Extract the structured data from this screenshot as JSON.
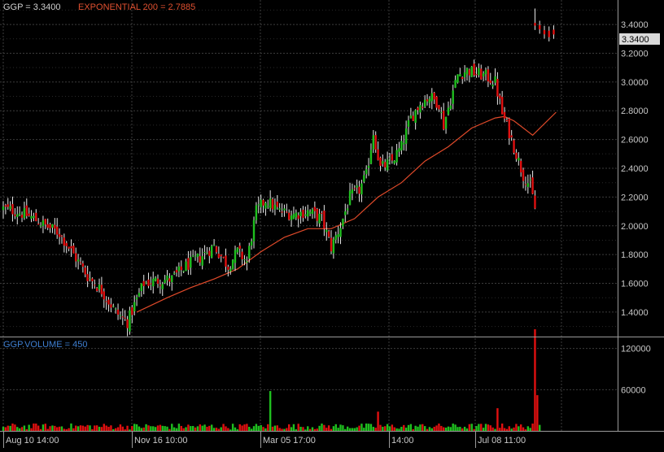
{
  "header": {
    "symbol_label": "GGP = 3.3400",
    "ema_label": "EXPONENTIAL 200 = 2.7885",
    "volume_label": "GGP.VOLUME = 450",
    "last_price_tag": "3.3400"
  },
  "colors": {
    "background": "#000000",
    "grid": "#3c3c3c",
    "up": "#1fbf1f",
    "down": "#e01010",
    "ema": "#e04a2a",
    "text": "#c8c8c8",
    "symbol_text": "#d0d0d0",
    "ema_text": "#e05030",
    "volume_text": "#3f7fd0"
  },
  "chart_data": [
    {
      "type": "candlestick",
      "title": "GGP = 3.3400",
      "x_tick_labels": [
        "Aug 10 14:00",
        "Nov 16 10:00",
        "Mar 05 17:00",
        "14:00",
        "Jul 08 11:00"
      ],
      "y_tick_labels": [
        "1.4000",
        "1.6000",
        "1.8000",
        "2.0000",
        "2.2000",
        "2.4000",
        "2.6000",
        "2.8000",
        "3.0000",
        "3.2000",
        "3.4000"
      ],
      "y_ticks": [
        1.4,
        1.6,
        1.8,
        2.0,
        2.2,
        2.4,
        2.6,
        2.8,
        3.0,
        3.2,
        3.4
      ],
      "ylim": [
        1.23,
        3.57
      ],
      "last_price": 3.34,
      "close_anchors": [
        [
          0,
          2.12
        ],
        [
          6,
          2.1
        ],
        [
          12,
          2.06
        ],
        [
          18,
          2.0
        ],
        [
          24,
          1.95
        ],
        [
          30,
          1.8
        ],
        [
          36,
          1.65
        ],
        [
          42,
          1.55
        ],
        [
          48,
          1.4
        ],
        [
          53,
          1.33
        ],
        [
          56,
          1.45
        ],
        [
          60,
          1.6
        ],
        [
          66,
          1.62
        ],
        [
          72,
          1.63
        ],
        [
          78,
          1.72
        ],
        [
          84,
          1.78
        ],
        [
          90,
          1.86
        ],
        [
          96,
          1.72
        ],
        [
          100,
          1.82
        ],
        [
          104,
          1.75
        ],
        [
          108,
          2.1
        ],
        [
          112,
          2.18
        ],
        [
          118,
          2.1
        ],
        [
          124,
          2.08
        ],
        [
          130,
          2.1
        ],
        [
          136,
          2.05
        ],
        [
          140,
          1.85
        ],
        [
          144,
          2.0
        ],
        [
          148,
          2.2
        ],
        [
          152,
          2.25
        ],
        [
          155,
          2.35
        ],
        [
          158,
          2.65
        ],
        [
          161,
          2.4
        ],
        [
          166,
          2.45
        ],
        [
          170,
          2.55
        ],
        [
          174,
          2.75
        ],
        [
          178,
          2.85
        ],
        [
          182,
          2.9
        ],
        [
          186,
          2.85
        ],
        [
          188,
          2.7
        ],
        [
          190,
          2.82
        ],
        [
          194,
          3.05
        ],
        [
          198,
          3.08
        ],
        [
          202,
          3.06
        ],
        [
          206,
          3.04
        ],
        [
          210,
          3.0
        ],
        [
          213,
          2.78
        ],
        [
          216,
          2.65
        ],
        [
          219,
          2.5
        ],
        [
          222,
          2.35
        ],
        [
          225,
          2.28
        ],
        [
          227,
          2.12
        ]
      ],
      "late_cluster": [
        [
          227,
          3.4
        ],
        [
          229,
          3.37
        ],
        [
          231,
          3.35
        ],
        [
          233,
          3.34
        ],
        [
          235,
          3.34
        ]
      ],
      "ema_series": {
        "name": "EXPONENTIAL 200",
        "last_value": 2.7885,
        "points": [
          [
            57,
            1.4
          ],
          [
            70,
            1.5
          ],
          [
            80,
            1.57
          ],
          [
            90,
            1.63
          ],
          [
            100,
            1.7
          ],
          [
            110,
            1.82
          ],
          [
            120,
            1.92
          ],
          [
            130,
            1.98
          ],
          [
            140,
            1.98
          ],
          [
            150,
            2.05
          ],
          [
            160,
            2.2
          ],
          [
            170,
            2.3
          ],
          [
            180,
            2.45
          ],
          [
            190,
            2.55
          ],
          [
            200,
            2.68
          ],
          [
            210,
            2.75
          ],
          [
            214,
            2.76
          ],
          [
            218,
            2.73
          ],
          [
            226,
            2.63
          ],
          [
            236,
            2.79
          ]
        ]
      }
    },
    {
      "type": "bar",
      "title": "GGP.VOLUME = 450",
      "y_tick_labels": [
        "60000",
        "120000"
      ],
      "y_ticks": [
        60000,
        120000
      ],
      "ylim": [
        0,
        135000
      ],
      "last_value": 450,
      "spikes": [
        [
          114,
          58000
        ],
        [
          160,
          28000
        ],
        [
          211,
          33000
        ],
        [
          227,
          148000
        ],
        [
          228,
          52000
        ]
      ]
    }
  ]
}
